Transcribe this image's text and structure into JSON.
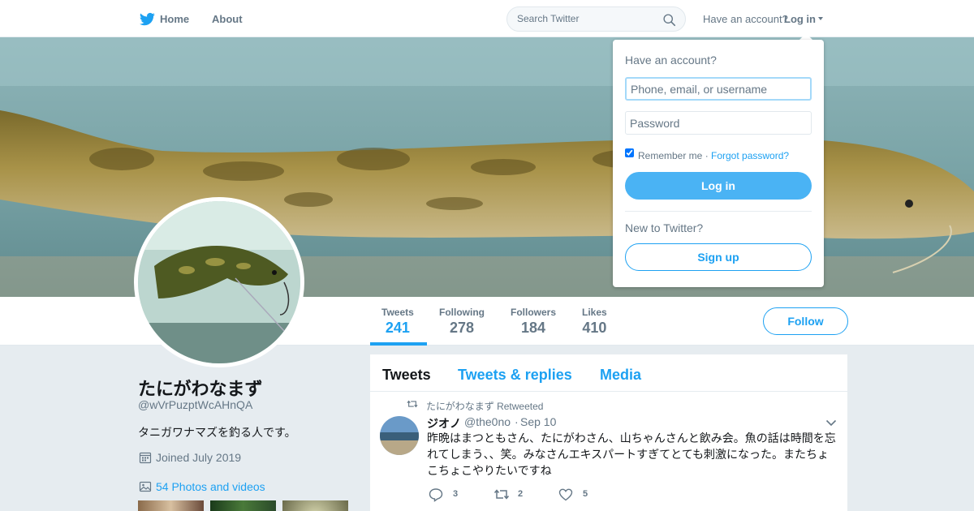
{
  "nav": {
    "home_label": "Home",
    "about_label": "About",
    "search_placeholder": "Search Twitter",
    "have_account": "Have an account?",
    "login_label": "Log in",
    "brand_color": "#1da1f2"
  },
  "profile": {
    "display_name": "たにがわなまず",
    "screen_name": "@wVrPuzptWcAHnQA",
    "bio": "タニガワナマズを釣る人です。",
    "joined": "Joined July 2019",
    "photos_link": "54 Photos and videos",
    "follow_label": "Follow"
  },
  "stats": [
    {
      "label": "Tweets",
      "value": "241",
      "active": true
    },
    {
      "label": "Following",
      "value": "278"
    },
    {
      "label": "Followers",
      "value": "184"
    },
    {
      "label": "Likes",
      "value": "410"
    }
  ],
  "timeline": {
    "tabs": [
      {
        "label": "Tweets",
        "active": true
      },
      {
        "label": "Tweets & replies"
      },
      {
        "label": "Media"
      }
    ],
    "tweet": {
      "retweeted_by": "たにがわなまず Retweeted",
      "name": "ジオノ",
      "handle": "@the0no",
      "separator": "·",
      "time": "Sep 10",
      "text": "昨晩はまつともさん、たにがわさん、山ちゃんさんと飲み会。魚の話は時間を忘れてしまう、、笑。みなさんエキスパートすぎてとても刺激になった。またちょこちょこやりたいですね",
      "reply_count": "3",
      "retweet_count": "2",
      "like_count": "5"
    }
  },
  "login_dropdown": {
    "title": "Have an account?",
    "username_placeholder": "Phone, email, or username",
    "password_placeholder": "Password",
    "remember_me": "Remember me ·",
    "forgot_password": "Forgot password?",
    "login_button": "Log in",
    "new_to_twitter": "New to Twitter?",
    "signup_button": "Sign up"
  },
  "icons": [
    "twitter-bird-icon",
    "search-icon",
    "chevron-down-icon",
    "calendar-icon",
    "photo-icon",
    "retweet-icon",
    "reply-icon",
    "like-icon"
  ]
}
